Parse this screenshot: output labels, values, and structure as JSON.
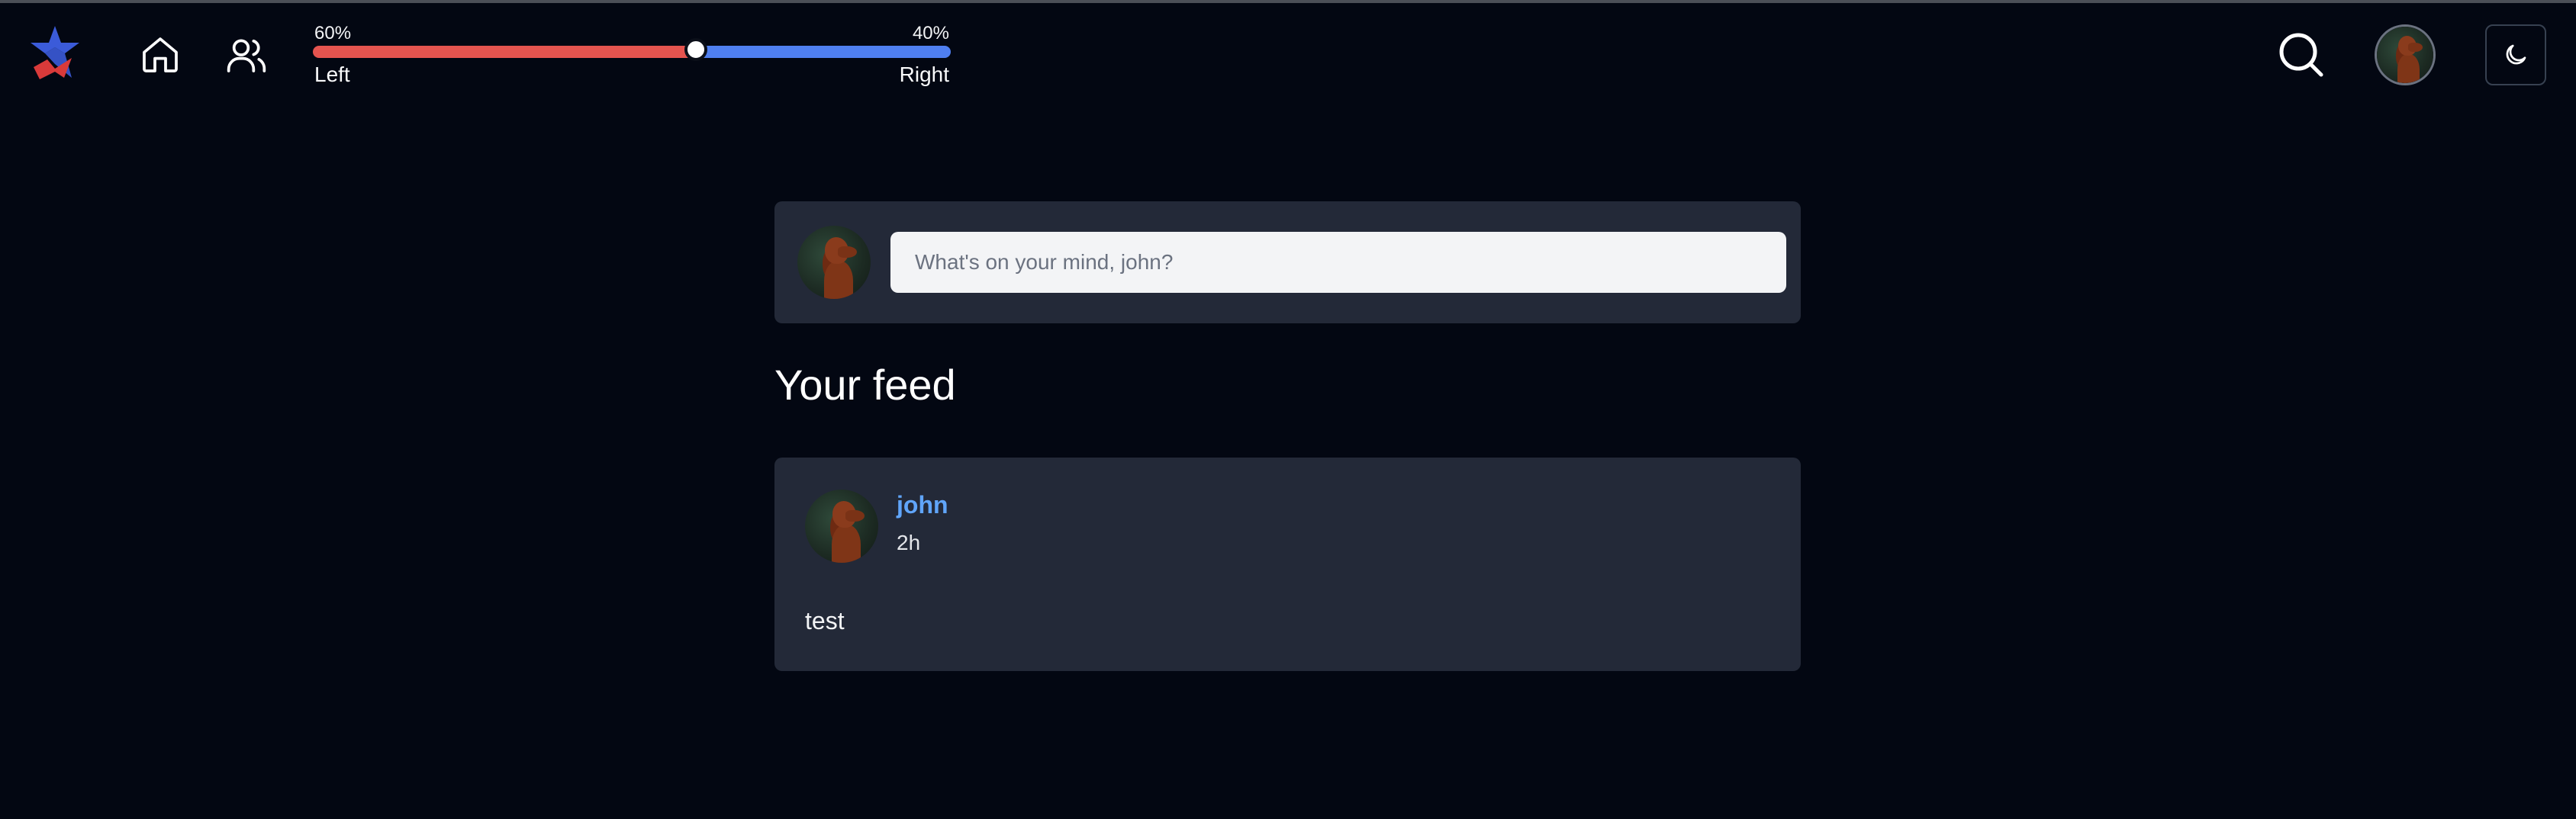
{
  "nav": {
    "logo_icon": "star-logo-icon",
    "home_icon": "home-icon",
    "friends_icon": "users-icon",
    "lean_meter": {
      "left_percent_label": "60%",
      "right_percent_label": "40%",
      "left_label": "Left",
      "right_label": "Right",
      "left_fraction": 0.6,
      "left_color": "#e5544f",
      "right_color": "#4f7ff0"
    },
    "search_icon": "search-icon",
    "theme_icon": "moon-icon"
  },
  "composer": {
    "placeholder": "What's on your mind, john?"
  },
  "feed": {
    "title": "Your feed",
    "posts": [
      {
        "author": "john",
        "time": "2h",
        "text": "test"
      }
    ]
  },
  "colors": {
    "background": "#030712",
    "card": "#232938",
    "author_link": "#60a5fa"
  }
}
